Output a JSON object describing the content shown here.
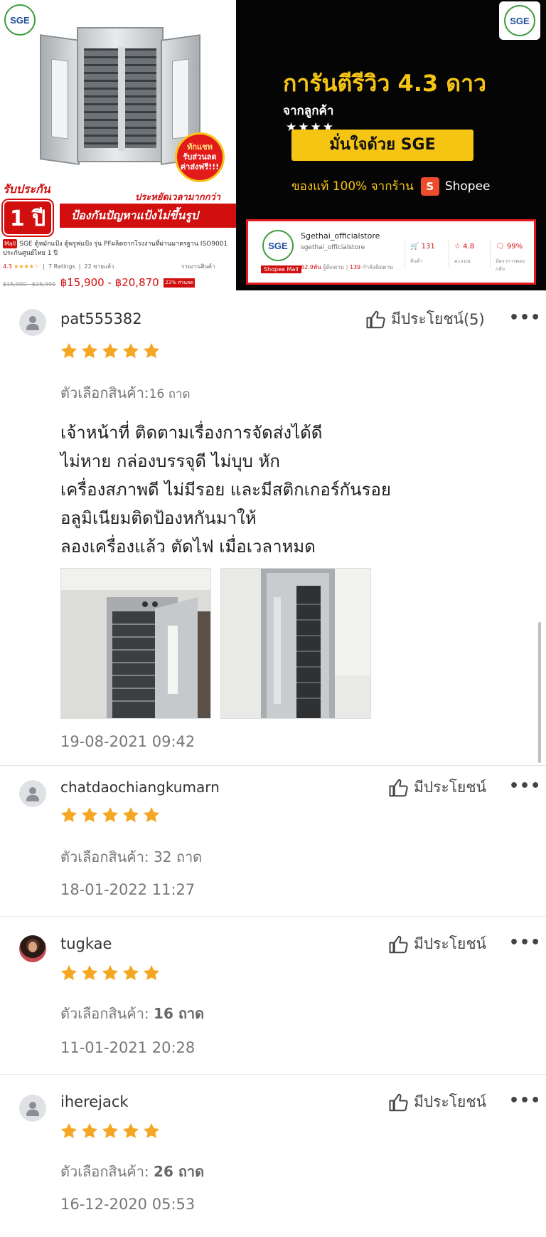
{
  "banner": {
    "logo_text": "SGE",
    "promo_badge": [
      "ทักแชท",
      "รับส่วนลด",
      "ค่าส่งฟรี!!!"
    ],
    "warranty_label": "รับประกัน",
    "warranty_years": "1 ปี",
    "save_tag": "ประหยัดเวลามากกว่า",
    "red_strip": "ป้องกันปัญหาแป้งไม่ขึ้นรูป",
    "mall_tag": "Mall",
    "product_title": "SGE ตู้หมักแป้ง ตู้พรูฟแป้ง รุ่น PFผลิตจากโรงงานที่ผ่านมาตรฐาน ISO9001 ประกันศูนย์ไทย 1 ปี",
    "rating_value": "4.3",
    "rating_stars": "★★★★☆",
    "ratings_count": "7",
    "ratings_label": "Ratings",
    "sold_count": "22",
    "sold_label": "ขายแล้ว",
    "report_label": "รายงานสินค้า",
    "old_price": "฿15,900 - ฿26,990",
    "price": "฿15,900 - ฿20,870",
    "discount": "22% ส่วนลด",
    "guarantee_title": "การันตีรีวิว 4.3 ดาว",
    "guarantee_sub": "จากลูกค้า",
    "guarantee_stars": "★★★★",
    "sure_button": "มั่นใจด้วย SGE",
    "authentic_text": "ของแท้ 100% จากร้าน",
    "shopee_icon_letter": "S",
    "shopee_label": "Shopee",
    "store": {
      "mall_label": "Shopee Mall",
      "name": "Sgethai_officialstore",
      "handle": "sgethai_officialstore",
      "followers": "62.9พัน",
      "followers_label": "ผู้ติดตาม",
      "following": "139",
      "following_label": "กำลังติดตาม",
      "products": "131",
      "products_label": "สินค้า",
      "rating": "4.8",
      "rating_label": "คะแนน",
      "chat": "99%",
      "chat_label": "อัตราการตอบกลับ"
    }
  },
  "colors": {
    "star": "#f5a623",
    "brand_red": "#d10f0f",
    "gold": "#f6c514",
    "shopee_orange": "#ee4d2d"
  },
  "reviews": [
    {
      "username": "pat555382",
      "avatar": "default-avatar",
      "helpful_label": "มีประโยชน์",
      "helpful_count": "(5)",
      "rating": 5,
      "variation_label": "ตัวเลือกสินค้า:",
      "variation_value": "16 ถาด",
      "comment_lines": [
        "เจ้าหน้าที่ ติดตามเรื่องการจัดส่งได้ดี",
        "ไม่หาย กล่องบรรจุดี ไม่บุบ หัก",
        "เครื่องสภาพดี ไม่มีรอย และมีสติกเกอร์กันรอย",
        "อลูมิเนียมติดป้องหกันมาให้",
        "ลองเครื่องแล้ว ตัดไฟ เมื่อเวลาหมด"
      ],
      "photos": [
        "cabinet-open-door-photo",
        "cabinet-closed-photo"
      ],
      "date": "19-08-2021 09:42"
    },
    {
      "username": "chatdaochiangkumarn",
      "avatar": "default-avatar",
      "helpful_label": "มีประโยชน์",
      "rating": 5,
      "variation_label": "ตัวเลือกสินค้า:",
      "variation_value": "32 ถาด",
      "date": "18-01-2022 11:27"
    },
    {
      "username": "tugkae",
      "avatar": "photo-avatar",
      "helpful_label": "มีประโยชน์",
      "rating": 5,
      "variation_label": "ตัวเลือกสินค้า:",
      "variation_value": "16 ถาด",
      "date": "11-01-2021 20:28"
    },
    {
      "username": "iherejack",
      "avatar": "default-avatar",
      "helpful_label": "มีประโยชน์",
      "rating": 5,
      "variation_label": "ตัวเลือกสินค้า:",
      "variation_value": "26 ถาด",
      "date": "16-12-2020 05:53"
    }
  ]
}
